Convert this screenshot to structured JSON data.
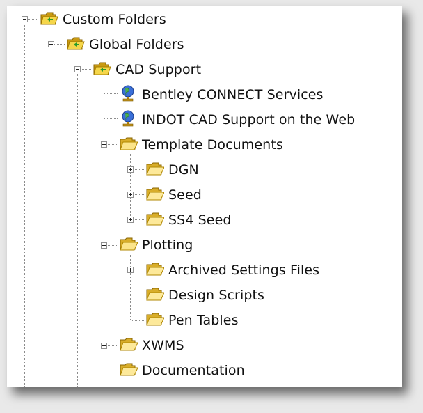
{
  "tree": {
    "nodes": [
      {
        "label": "Custom Folders",
        "icon": "special-folder-icon",
        "expander": "minus"
      },
      {
        "label": "Global Folders",
        "icon": "special-folder-icon",
        "expander": "minus"
      },
      {
        "label": "CAD Support",
        "icon": "special-folder-icon",
        "expander": "minus"
      },
      {
        "label": "Bentley CONNECT Services",
        "icon": "web-globe-icon",
        "expander": "none"
      },
      {
        "label": "INDOT CAD Support on the Web",
        "icon": "web-globe-icon",
        "expander": "none"
      },
      {
        "label": "Template Documents",
        "icon": "open-folder-icon",
        "expander": "minus"
      },
      {
        "label": "DGN",
        "icon": "folder-icon",
        "expander": "plus"
      },
      {
        "label": "Seed",
        "icon": "folder-icon",
        "expander": "plus"
      },
      {
        "label": "SS4 Seed",
        "icon": "folder-icon",
        "expander": "plus"
      },
      {
        "label": "Plotting",
        "icon": "open-folder-icon",
        "expander": "minus"
      },
      {
        "label": "Archived Settings Files",
        "icon": "folder-icon",
        "expander": "plus"
      },
      {
        "label": "Design Scripts",
        "icon": "folder-icon",
        "expander": "none"
      },
      {
        "label": "Pen Tables",
        "icon": "folder-icon",
        "expander": "none"
      },
      {
        "label": "XWMS",
        "icon": "folder-icon",
        "expander": "plus"
      },
      {
        "label": "Documentation",
        "icon": "folder-icon",
        "expander": "none"
      }
    ]
  }
}
